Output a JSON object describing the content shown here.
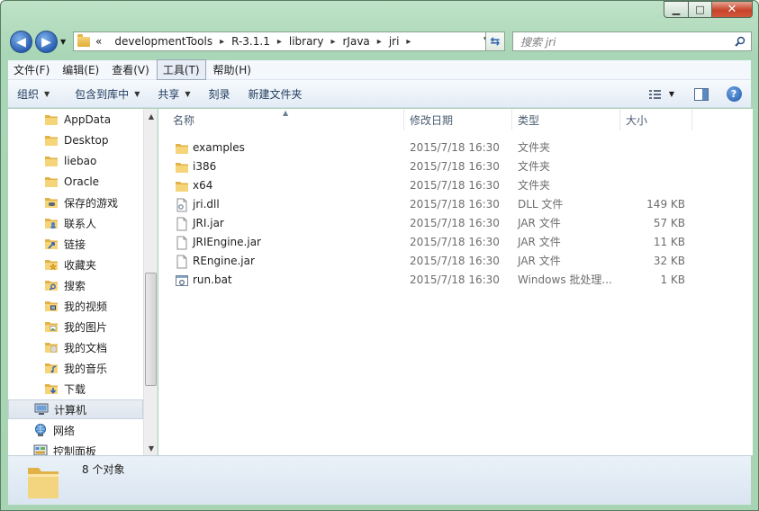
{
  "window": {
    "caption_buttons": {
      "minimize": "▁",
      "maximize": "□",
      "close": "✕"
    }
  },
  "nav": {
    "back_arrow": "◀",
    "forward_arrow": "▶",
    "history_arrow": "▼",
    "breadcrumb_lead": "«",
    "breadcrumbs": [
      "developmentTools",
      "R-3.1.1",
      "library",
      "rJava",
      "jri"
    ],
    "separator": "▸",
    "address_dropdown": "▼",
    "refresh_icon": "⇆",
    "search_placeholder": "搜索 jri"
  },
  "menu": [
    "文件(F)",
    "编辑(E)",
    "查看(V)",
    "工具(T)",
    "帮助(H)"
  ],
  "toolbar": {
    "organize": "组织",
    "include_in_library": "包含到库中",
    "share": "共享",
    "burn": "刻录",
    "new_folder": "新建文件夹",
    "dropdown_arrow": "▼",
    "help": "?"
  },
  "sidebar": {
    "items": [
      {
        "label": "AppData",
        "icon": "folder-icon"
      },
      {
        "label": "Desktop",
        "icon": "folder-icon"
      },
      {
        "label": "liebao",
        "icon": "folder-icon"
      },
      {
        "label": "Oracle",
        "icon": "folder-icon"
      },
      {
        "label": "保存的游戏",
        "icon": "saved-games-icon"
      },
      {
        "label": "联系人",
        "icon": "contacts-icon"
      },
      {
        "label": "链接",
        "icon": "links-icon"
      },
      {
        "label": "收藏夹",
        "icon": "favorites-icon"
      },
      {
        "label": "搜索",
        "icon": "searches-icon"
      },
      {
        "label": "我的视频",
        "icon": "videos-icon"
      },
      {
        "label": "我的图片",
        "icon": "pictures-icon"
      },
      {
        "label": "我的文档",
        "icon": "documents-icon"
      },
      {
        "label": "我的音乐",
        "icon": "music-icon"
      },
      {
        "label": "下载",
        "icon": "downloads-icon"
      },
      {
        "label": "计算机",
        "icon": "computer-icon"
      },
      {
        "label": "网络",
        "icon": "network-icon"
      },
      {
        "label": "控制面板",
        "icon": "control-panel-icon"
      }
    ],
    "scroll_up": "▲",
    "scroll_down": "▼"
  },
  "columns": {
    "name": "名称",
    "date": "修改日期",
    "type": "类型",
    "size": "大小",
    "sort_indicator": "▲"
  },
  "files": [
    {
      "name": "examples",
      "date": "2015/7/18 16:30",
      "type": "文件夹",
      "size": "",
      "icon": "folder-icon"
    },
    {
      "name": "i386",
      "date": "2015/7/18 16:30",
      "type": "文件夹",
      "size": "",
      "icon": "folder-icon"
    },
    {
      "name": "x64",
      "date": "2015/7/18 16:30",
      "type": "文件夹",
      "size": "",
      "icon": "folder-icon"
    },
    {
      "name": "jri.dll",
      "date": "2015/7/18 16:30",
      "type": "DLL 文件",
      "size": "149 KB",
      "icon": "dll-file-icon"
    },
    {
      "name": "JRI.jar",
      "date": "2015/7/18 16:30",
      "type": "JAR 文件",
      "size": "57 KB",
      "icon": "file-icon"
    },
    {
      "name": "JRIEngine.jar",
      "date": "2015/7/18 16:30",
      "type": "JAR 文件",
      "size": "11 KB",
      "icon": "file-icon"
    },
    {
      "name": "REngine.jar",
      "date": "2015/7/18 16:30",
      "type": "JAR 文件",
      "size": "32 KB",
      "icon": "file-icon"
    },
    {
      "name": "run.bat",
      "date": "2015/7/18 16:30",
      "type": "Windows 批处理...",
      "size": "1 KB",
      "icon": "batch-file-icon"
    }
  ],
  "status": {
    "text": "8 个对象"
  }
}
